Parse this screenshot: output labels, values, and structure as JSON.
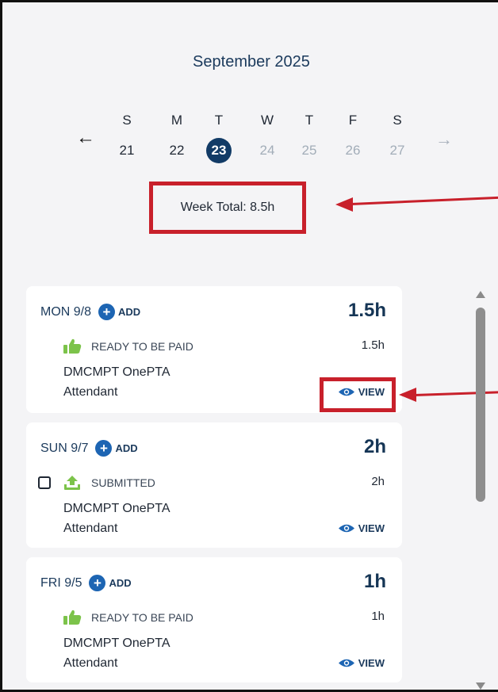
{
  "calendar": {
    "month_label": "September 2025",
    "prev_icon": "arrow-left-icon",
    "next_icon": "arrow-right-icon",
    "days": [
      {
        "dow": "S",
        "date": "21",
        "state": "past"
      },
      {
        "dow": "M",
        "date": "22",
        "state": "past"
      },
      {
        "dow": "T",
        "date": "23",
        "state": "selected"
      },
      {
        "dow": "W",
        "date": "24",
        "state": "future"
      },
      {
        "dow": "T",
        "date": "25",
        "state": "future"
      },
      {
        "dow": "F",
        "date": "26",
        "state": "future"
      },
      {
        "dow": "S",
        "date": "27",
        "state": "future"
      }
    ],
    "week_total": "Week Total: 8.5h"
  },
  "entries": [
    {
      "date": "MON 9/8",
      "add_label": "ADD",
      "total": "1.5h",
      "status": "READY TO BE PAID",
      "status_icon": "thumbs-up-icon",
      "hours": "1.5h",
      "name": "DMCMPT OnePTA",
      "role": "Attendant",
      "view_label": "VIEW",
      "has_checkbox": false
    },
    {
      "date": "SUN 9/7",
      "add_label": "ADD",
      "total": "2h",
      "status": "SUBMITTED",
      "status_icon": "upload-icon",
      "hours": "2h",
      "name": "DMCMPT OnePTA",
      "role": "Attendant",
      "view_label": "VIEW",
      "has_checkbox": true
    },
    {
      "date": "FRI 9/5",
      "add_label": "ADD",
      "total": "1h",
      "status": "READY TO BE PAID",
      "status_icon": "thumbs-up-icon",
      "hours": "1h",
      "name": "DMCMPT OnePTA",
      "role": "Attendant",
      "view_label": "VIEW",
      "has_checkbox": false
    }
  ],
  "colors": {
    "accent": "#123b66",
    "add_button": "#1d65b3",
    "ready_icon": "#7cc34a",
    "annotation": "#c8202b",
    "future_day": "#a2adb8"
  }
}
